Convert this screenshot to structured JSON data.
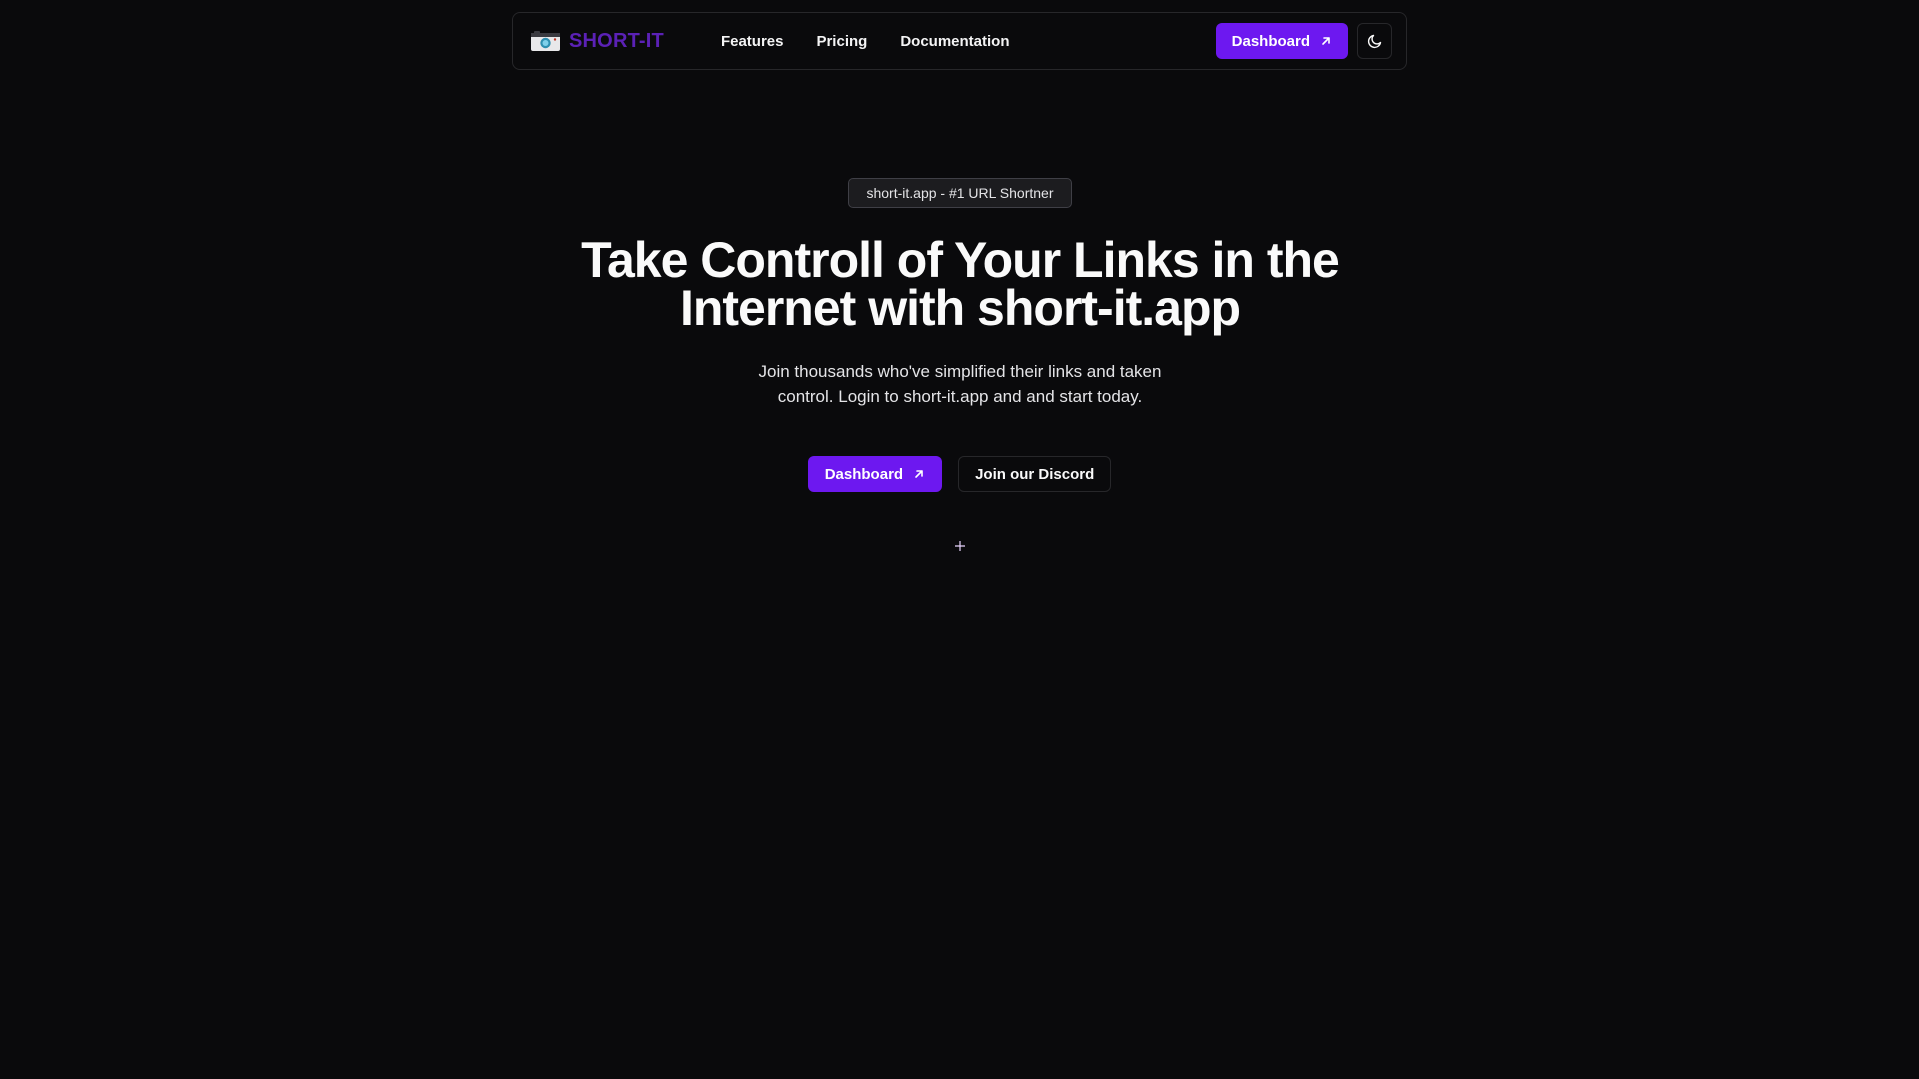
{
  "brand": {
    "name": "SHORT-IT",
    "logo_icon": "camera-icon"
  },
  "nav": {
    "links": [
      "Features",
      "Pricing",
      "Documentation"
    ],
    "dashboard_label": "Dashboard",
    "theme_icon": "moon-icon"
  },
  "hero": {
    "badge": "short-it.app - #1 URL Shortner",
    "title": "Take Controll of Your Links in the Internet with short-it.app",
    "subtitle": "Join thousands who've simplified their links and taken control. Login to short-it.app and and start today.",
    "primary_cta": "Dashboard",
    "secondary_cta": "Join our Discord"
  },
  "colors": {
    "background": "#0a0a0c",
    "accent": "#6d18f0",
    "brand_text": "#5b21b6"
  }
}
